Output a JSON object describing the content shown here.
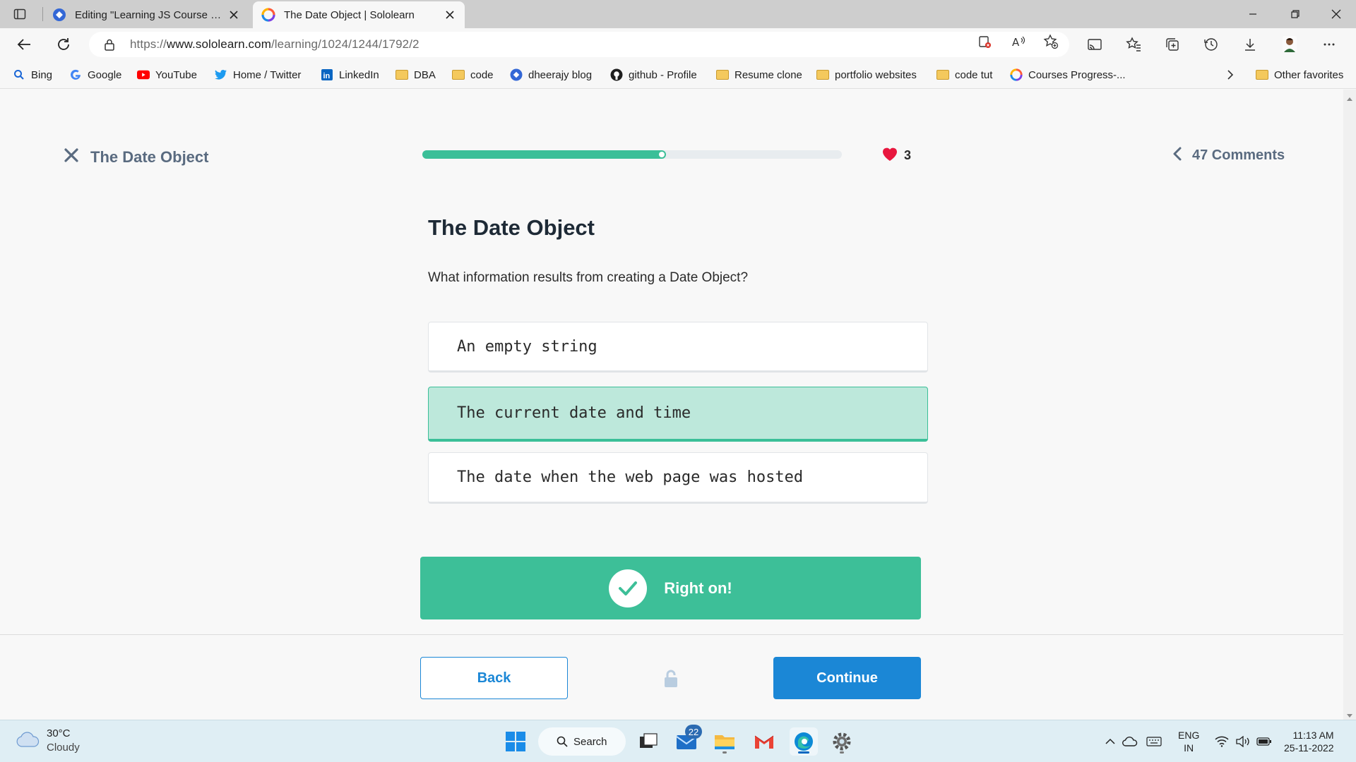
{
  "browser": {
    "tabs": [
      {
        "title": "Editing \"Learning JS Course @Sc",
        "active": false
      },
      {
        "title": "The Date Object | Sololearn",
        "active": true
      }
    ],
    "url_prefix": "https://",
    "url_domain": "www.sololearn.com",
    "url_path": "/learning/1024/1244/1792/2",
    "favorites": [
      {
        "label": "Bing",
        "icon": "bing-icon"
      },
      {
        "label": "Google",
        "icon": "google-icon"
      },
      {
        "label": "YouTube",
        "icon": "youtube-icon"
      },
      {
        "label": "Home / Twitter",
        "icon": "twitter-icon"
      },
      {
        "label": "LinkedIn",
        "icon": "linkedin-icon"
      },
      {
        "label": "DBA",
        "icon": "folder-icon"
      },
      {
        "label": "code",
        "icon": "folder-icon"
      },
      {
        "label": "dheerajy blog",
        "icon": "blog-icon"
      },
      {
        "label": "github - Profile",
        "icon": "github-icon"
      },
      {
        "label": "Resume clone",
        "icon": "folder-icon"
      },
      {
        "label": "portfolio websites",
        "icon": "folder-icon"
      },
      {
        "label": "code tut",
        "icon": "folder-icon"
      },
      {
        "label": "Courses Progress-...",
        "icon": "sololearn-icon"
      }
    ],
    "other_favorites": "Other favorites"
  },
  "lesson": {
    "title": "The Date Object",
    "progress": 0.58,
    "hearts": "3",
    "comments": "47 Comments"
  },
  "question": {
    "title": "The Date Object",
    "text": "What information results from creating a Date Object?",
    "options": [
      {
        "text": "An empty string",
        "selected": false
      },
      {
        "text": "The current date and time",
        "selected": true
      },
      {
        "text": "The date when the web page was hosted",
        "selected": false
      }
    ]
  },
  "feedback": {
    "message": "Right on!"
  },
  "footer": {
    "back": "Back",
    "continue": "Continue"
  },
  "taskbar": {
    "weather_temp": "30°C",
    "weather_desc": "Cloudy",
    "search_label": "Search",
    "mail_badge": "22",
    "lang_line1": "ENG",
    "lang_line2": "IN",
    "time": "11:13 AM",
    "date": "25-11-2022"
  },
  "colors": {
    "accent_green": "#3dbf98",
    "selected_bg": "#bde8db",
    "primary_blue": "#1b87d6",
    "heart": "#e8173e"
  }
}
